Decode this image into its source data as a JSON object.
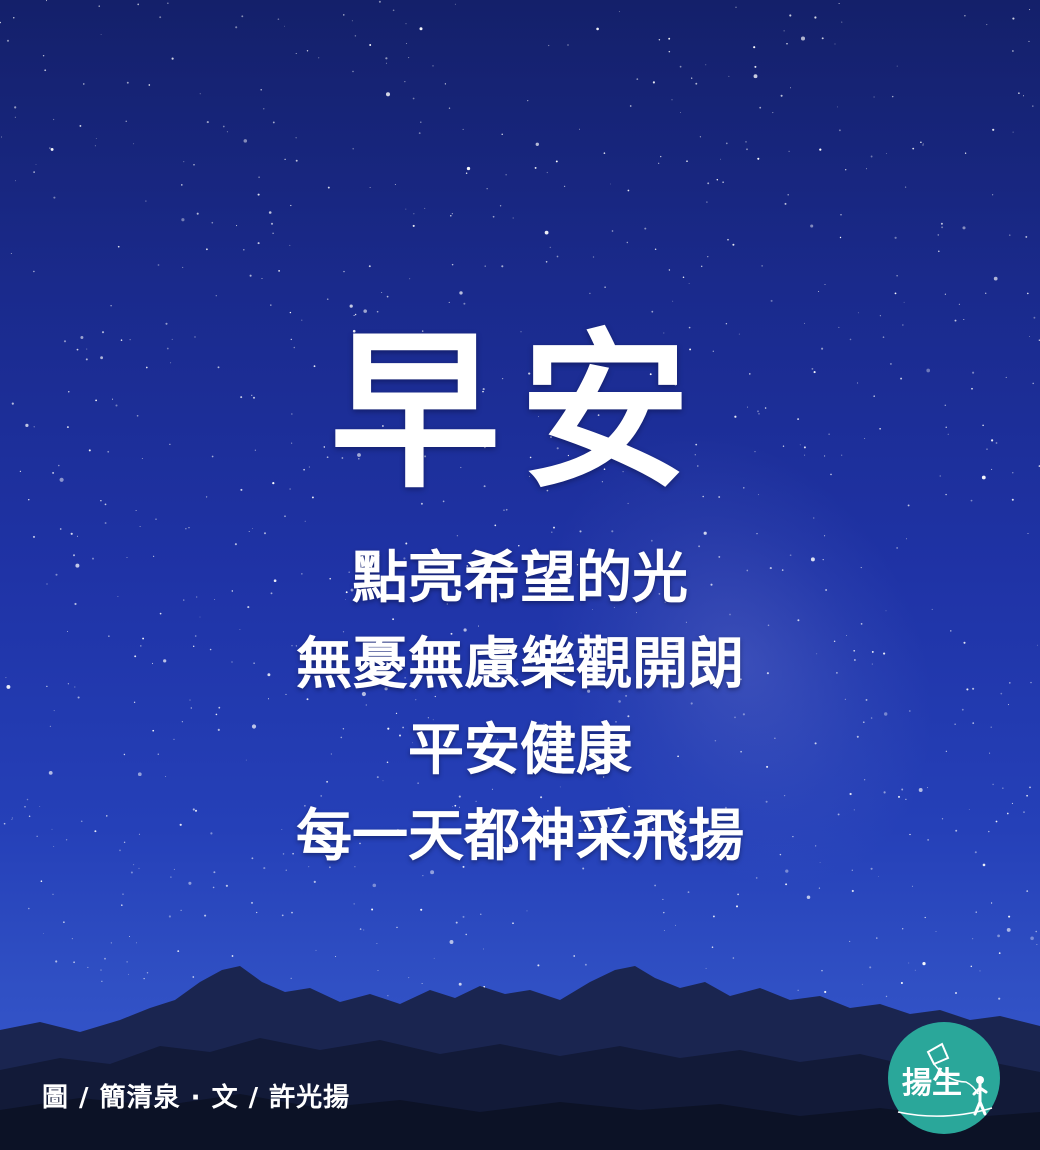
{
  "title": "早安",
  "lines": [
    "點亮希望的光",
    "無憂無慮樂觀開朗",
    "平安健康",
    "每一天都神采飛揚"
  ],
  "credit": "圖 / 簡清泉 · 文 / 許光揚",
  "logo": {
    "text": "揚生",
    "color": "#2aa79a"
  },
  "colors": {
    "sky_top": "#14206a",
    "sky_bottom": "#3a5ad0",
    "text": "#ffffff"
  }
}
